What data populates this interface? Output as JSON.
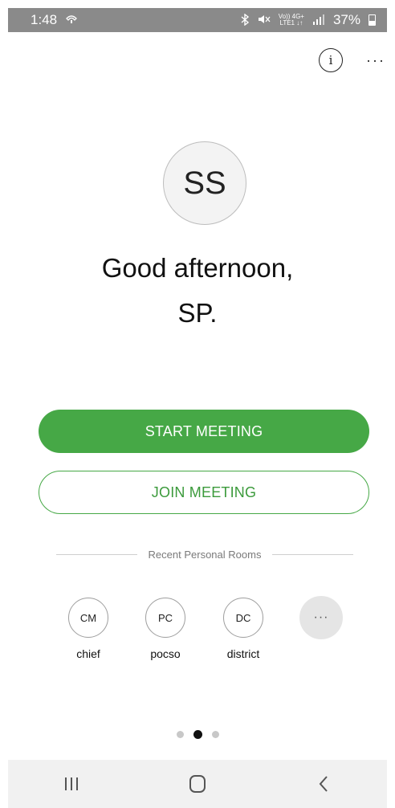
{
  "status_bar": {
    "time": "1:48",
    "battery": "37%",
    "network_small_top": "Vo)) 4G+",
    "network_small_bottom": "LTE1 ↓↑"
  },
  "header": {
    "info_label": "i",
    "more_label": "···"
  },
  "profile": {
    "initials": "SS",
    "greeting_line1": "Good afternoon,",
    "greeting_line2": "SP."
  },
  "actions": {
    "start_label": "START MEETING",
    "join_label": "JOIN MEETING"
  },
  "recent": {
    "title": "Recent Personal Rooms",
    "rooms": [
      {
        "initials": "CM",
        "label": "chief"
      },
      {
        "initials": "PC",
        "label": "pocso"
      },
      {
        "initials": "DC",
        "label": "district"
      }
    ],
    "more_label": "···"
  },
  "pager": {
    "count": 3,
    "active_index": 1
  },
  "colors": {
    "accent_green": "#46a846",
    "status_bar_bg": "#8a8a8a",
    "nav_bar_bg": "#f1f1f1"
  },
  "icons": {
    "status": [
      "call-icon",
      "bluetooth-icon",
      "mute-icon",
      "signal-icon",
      "battery-icon"
    ],
    "nav": [
      "recents-icon",
      "home-icon",
      "back-icon"
    ]
  }
}
